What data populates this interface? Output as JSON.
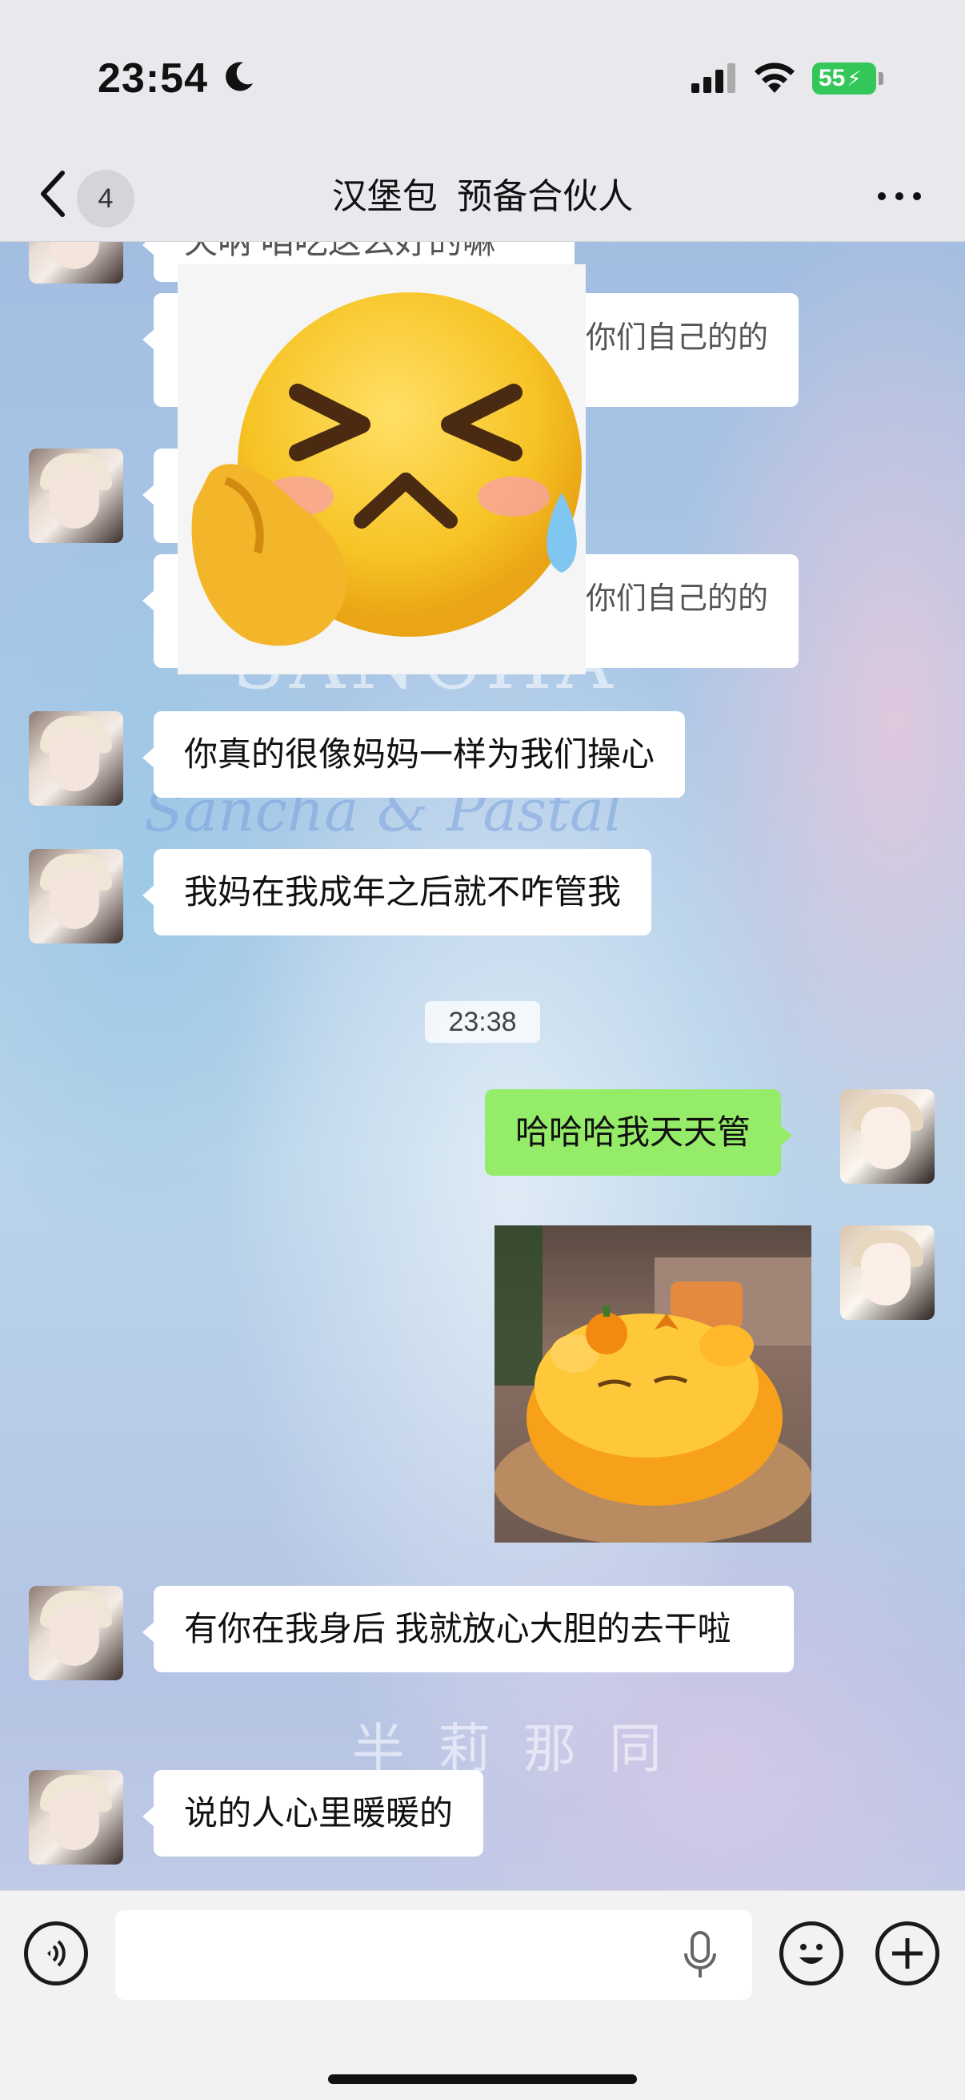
{
  "status_bar": {
    "time": "23:54",
    "battery": "55",
    "icons": [
      "moon-icon",
      "cellular-signal-icon",
      "wifi-icon",
      "battery-charging-icon"
    ]
  },
  "nav": {
    "unread_count": "4",
    "title": "汉堡包  预备合伙人",
    "icons": [
      "chevron-left-icon",
      "more-icon"
    ]
  },
  "background_text": [
    "SANCHA",
    "Sancha & Pastal",
    "半 莉 那 同"
  ],
  "messages": [
    {
      "side": "in",
      "type": "text",
      "text": "天呐 咱吃这么好的嘛",
      "partial": true
    },
    {
      "side": "in",
      "type": "text",
      "text": "你们自己的的",
      "partial": true
    },
    {
      "side": "in",
      "type": "sticker",
      "text": "cry-laugh-emoji-sticker"
    },
    {
      "side": "in",
      "type": "text",
      "text": "你们自己的的",
      "partial": true
    },
    {
      "side": "in",
      "type": "text",
      "text": "你真的很像妈妈一样为我们操心"
    },
    {
      "side": "in",
      "type": "text",
      "text": "我妈在我成年之后就不咋管我"
    },
    {
      "side": "system",
      "type": "timestamp",
      "text": "23:38"
    },
    {
      "side": "out",
      "type": "text",
      "text": "哈哈哈我天天管"
    },
    {
      "side": "out",
      "type": "image",
      "text": "orange-cow-plush-image"
    },
    {
      "side": "in",
      "type": "text",
      "text": "有你在我身后 我就放心大胆的去干啦"
    },
    {
      "side": "in",
      "type": "text",
      "text": "说的人心里暖暖的"
    }
  ],
  "composer": {
    "icons": [
      "voice-mode-icon",
      "microphone-icon",
      "emoji-icon",
      "add-icon"
    ]
  },
  "colors": {
    "outgoing_bubble": "#95ec69",
    "incoming_bubble": "#ffffff",
    "battery": "#33c759"
  }
}
